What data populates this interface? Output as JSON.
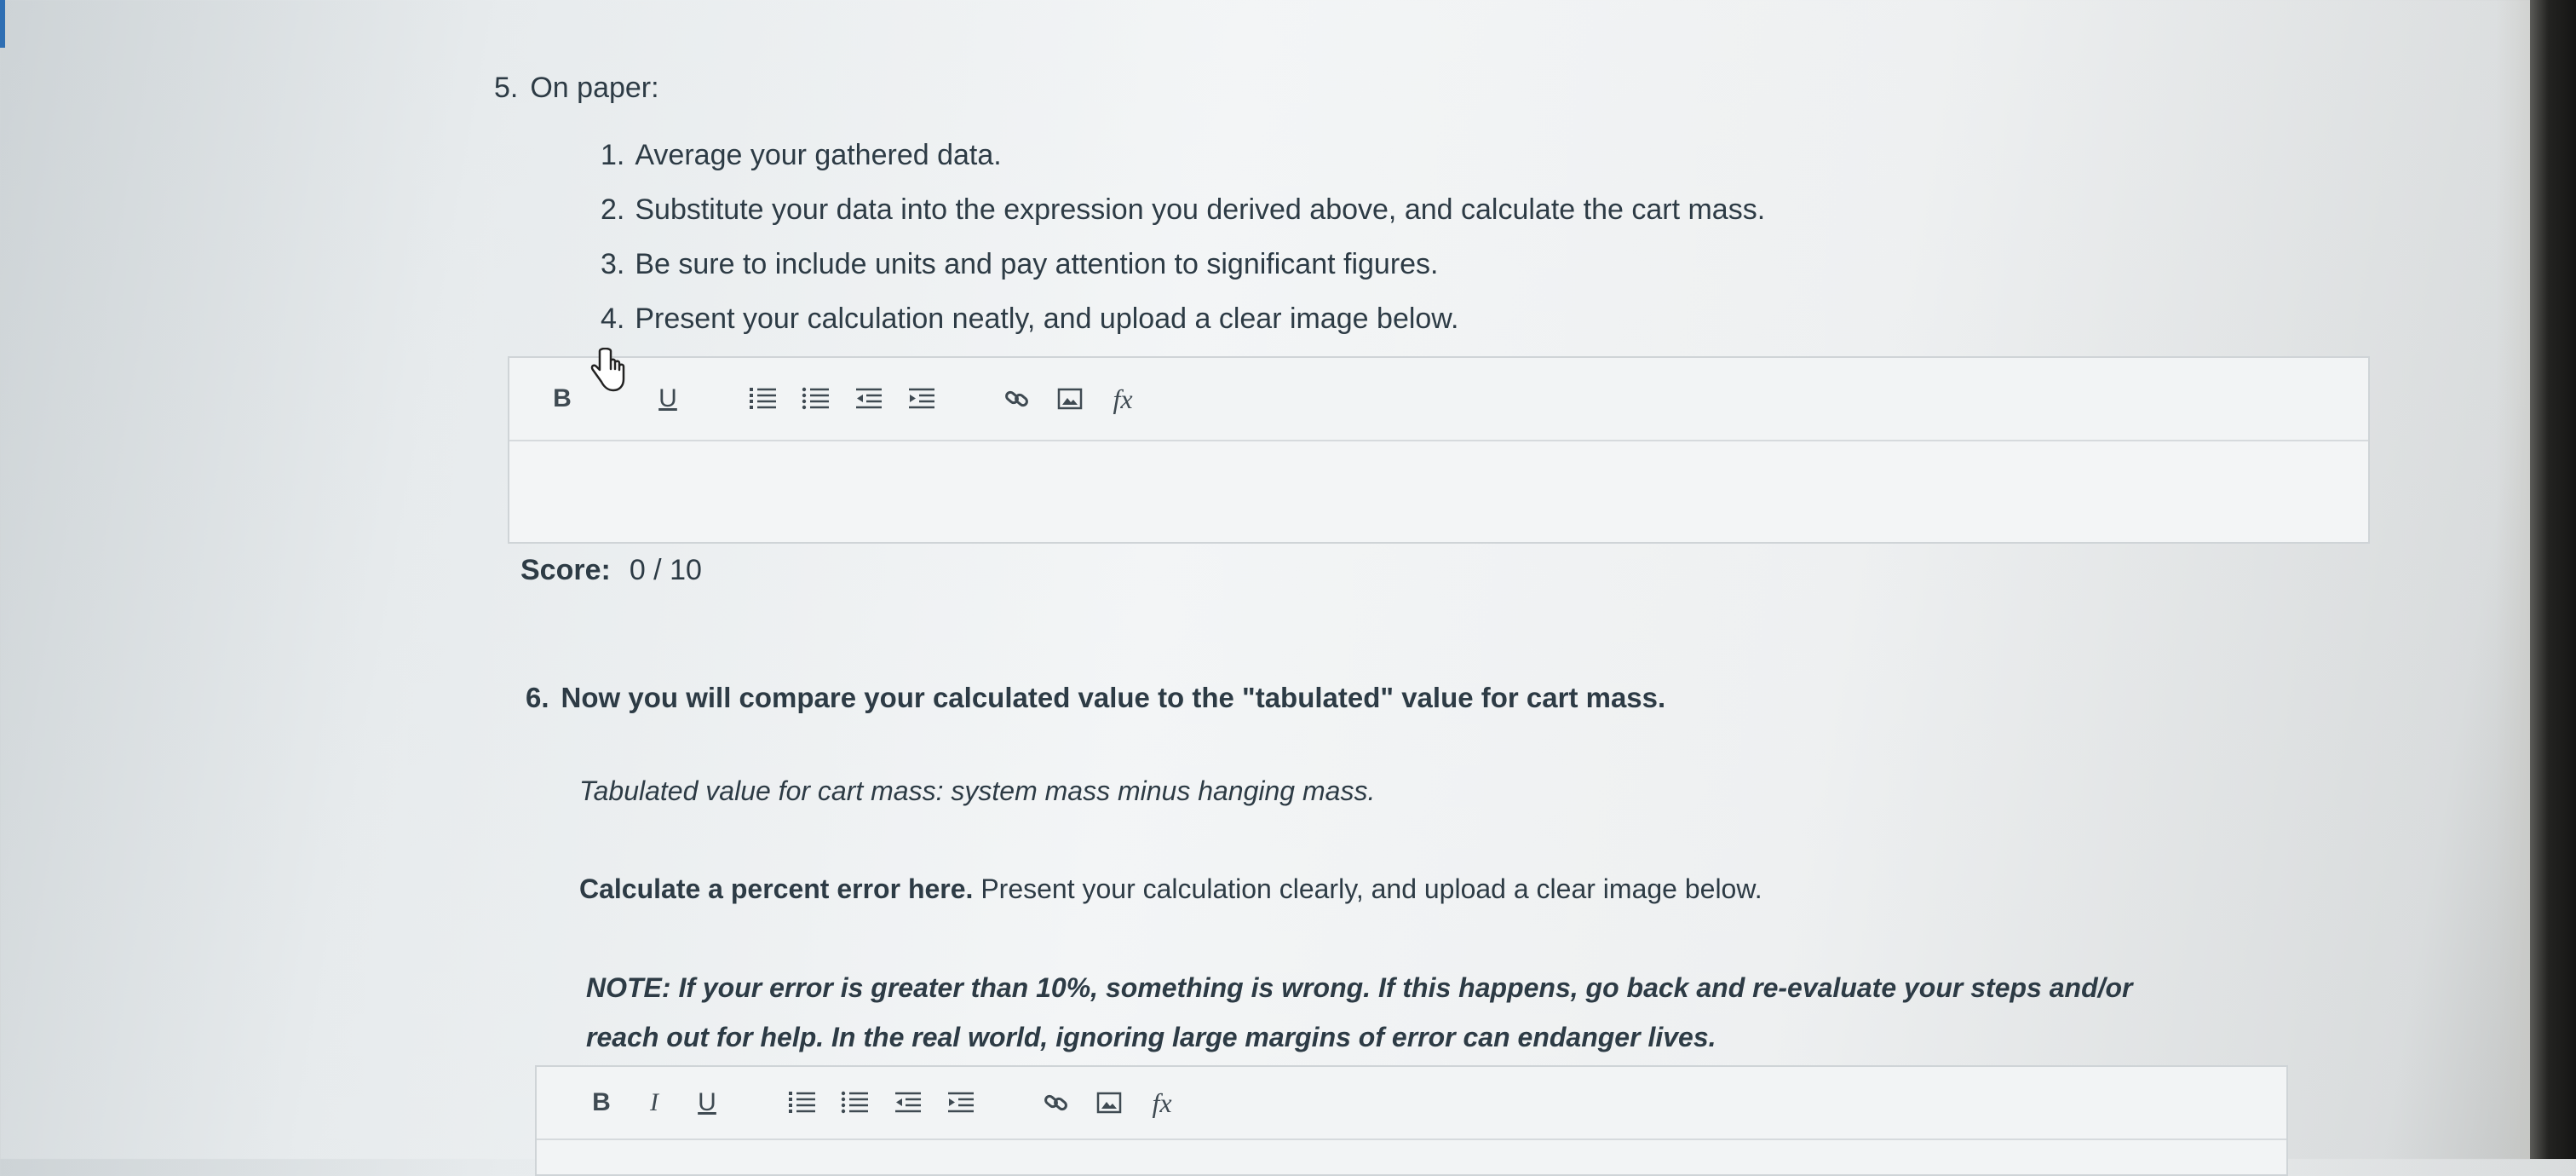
{
  "colors": {
    "text": "#2d3b45",
    "editor_border": "#cfd4d7",
    "accent": "#2f6fb3"
  },
  "q5": {
    "number": "5.",
    "title": "On paper:",
    "items": [
      {
        "num": "1.",
        "text": "Average your gathered data."
      },
      {
        "num": "2.",
        "text": "Substitute your data into the expression you derived above, and calculate the cart mass."
      },
      {
        "num": "3.",
        "text": "Be sure to include units and pay attention to significant figures."
      },
      {
        "num": "4.",
        "text": "Present your calculation neatly, and upload a clear image below."
      }
    ]
  },
  "editor1": {
    "toolbar": {
      "bold": "B",
      "underline": "U",
      "formula": "fx",
      "icons": [
        "bold-icon",
        "italic-icon",
        "underline-icon",
        "ordered-list-icon",
        "unordered-list-icon",
        "outdent-icon",
        "indent-icon",
        "link-icon",
        "image-icon",
        "formula-icon"
      ]
    }
  },
  "score": {
    "label": "Score:",
    "value": "0 / 10"
  },
  "q6": {
    "number": "6.",
    "title": "Now you will compare your calculated value to the \"tabulated\" value for cart mass.",
    "tabulated": "Tabulated value for cart mass: system mass minus hanging mass.",
    "calc_bold": "Calculate a percent error here.",
    "calc_rest": " Present your calculation clearly, and upload a clear image below.",
    "note_line1": "NOTE: If your error is greater than 10%, something is wrong. If this happens, go back and re-evaluate your steps and/or",
    "note_line2": "reach out for help. In the real world, ignoring large margins of error can endanger lives."
  },
  "editor2": {
    "toolbar": {
      "bold": "B",
      "italic": "I",
      "underline": "U",
      "formula": "fx"
    }
  }
}
